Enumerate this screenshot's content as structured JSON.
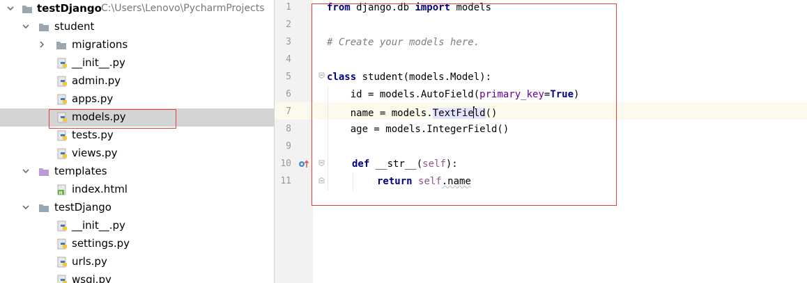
{
  "tree": {
    "items": [
      {
        "label": "testDjango",
        "path": "C:\\Users\\Lenovo\\PycharmProjects",
        "type": "folder",
        "expanded": true,
        "depth": 0,
        "bold": true
      },
      {
        "label": "student",
        "type": "folder",
        "expanded": true,
        "depth": 1
      },
      {
        "label": "migrations",
        "type": "folder",
        "expanded": false,
        "depth": 2
      },
      {
        "label": "__init__.py",
        "type": "python",
        "depth": 2
      },
      {
        "label": "admin.py",
        "type": "python",
        "depth": 2
      },
      {
        "label": "apps.py",
        "type": "python",
        "depth": 2
      },
      {
        "label": "models.py",
        "type": "python",
        "depth": 2,
        "selected": true
      },
      {
        "label": "tests.py",
        "type": "python",
        "depth": 2
      },
      {
        "label": "views.py",
        "type": "python",
        "depth": 2
      },
      {
        "label": "templates",
        "type": "folder-purple",
        "expanded": true,
        "depth": 1
      },
      {
        "label": "index.html",
        "type": "html",
        "depth": 2
      },
      {
        "label": "testDjango",
        "type": "folder",
        "expanded": true,
        "depth": 1
      },
      {
        "label": "__init__.py",
        "type": "python",
        "depth": 2
      },
      {
        "label": "settings.py",
        "type": "python",
        "depth": 2
      },
      {
        "label": "urls.py",
        "type": "python",
        "depth": 2
      },
      {
        "label": "wsgi.py",
        "type": "python",
        "depth": 2
      }
    ]
  },
  "editor": {
    "line_numbers": [
      "1",
      "2",
      "3",
      "4",
      "5",
      "6",
      "7",
      "8",
      "9",
      "10",
      "11"
    ],
    "current_line": 7,
    "code": {
      "l1_from": "from",
      "l1_mod": " django.db ",
      "l1_import": "import",
      "l1_rest": " models",
      "l3_comment": "# Create your models here.",
      "l5_class": "class",
      "l5_rest": " student(models.Model):",
      "l6_a": "    id = models.AutoField(",
      "l6_param": "primary_key",
      "l6_eq": "=",
      "l6_true": "True",
      "l6_close": ")",
      "l7_a": "    name = models.",
      "l7_sel_a": "TextFie",
      "l7_sel_b": "ld",
      "l7_end": "()",
      "l8": "    age = models.IntegerField()",
      "l10_def": "def",
      "l10_name": " __str__(",
      "l10_self": "self",
      "l10_end": "):",
      "l11_return": "return",
      "l11_self": "self",
      "l11_rest": ".name"
    }
  },
  "colors": {
    "keyword": "#000080",
    "comment": "#808080",
    "param": "#660099",
    "self": "#94558d",
    "highlight_box": "#e0413f",
    "selection_row": "#d4d4d4"
  }
}
